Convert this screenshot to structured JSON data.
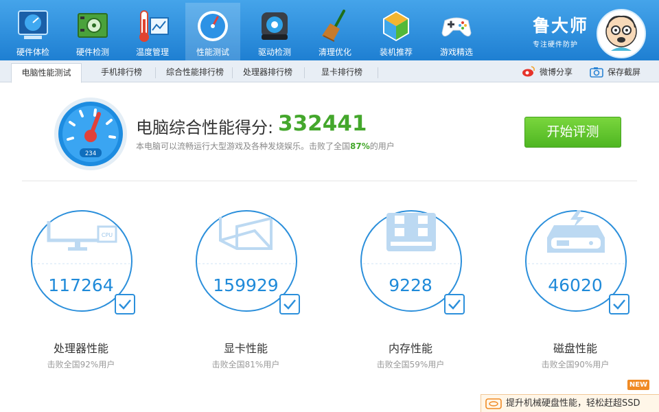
{
  "toolbar": {
    "items": [
      {
        "label": "硬件体检",
        "icon": "hardware-checkup-icon"
      },
      {
        "label": "硬件检测",
        "icon": "hardware-detect-icon"
      },
      {
        "label": "温度管理",
        "icon": "temperature-icon"
      },
      {
        "label": "性能测试",
        "icon": "performance-gauge-icon",
        "active": true
      },
      {
        "label": "驱动检测",
        "icon": "driver-icon"
      },
      {
        "label": "清理优化",
        "icon": "broom-icon"
      },
      {
        "label": "装机推荐",
        "icon": "install-recommend-icon"
      },
      {
        "label": "游戏精选",
        "icon": "gamepad-icon"
      }
    ],
    "brand_name": "鲁大师",
    "brand_sub": "专注硬件防护"
  },
  "tabs": [
    {
      "label": "电脑性能测试",
      "active": true
    },
    {
      "label": "手机排行榜"
    },
    {
      "label": "综合性能排行榜"
    },
    {
      "label": "处理器排行榜"
    },
    {
      "label": "显卡排行榜"
    }
  ],
  "share": {
    "weibo_label": "微博分享",
    "screenshot_label": "保存截屏"
  },
  "score": {
    "title": "电脑综合性能得分:",
    "value": "332441",
    "gauge_digits": "234",
    "desc_prefix": "本电脑可以流畅运行大型游戏及各种发烧娱乐。击败了全国",
    "desc_pct": "87%",
    "desc_suffix": "的用户",
    "start_button": "开始评测"
  },
  "cards": [
    {
      "value": "117264",
      "name": "处理器性能",
      "sub": "击败全国92%用户",
      "icon": "cpu-monitor-icon",
      "chip_text": "CPU"
    },
    {
      "value": "159929",
      "name": "显卡性能",
      "sub": "击败全国81%用户",
      "icon": "graphics-cube-icon"
    },
    {
      "value": "9228",
      "name": "内存性能",
      "sub": "击败全国59%用户",
      "icon": "memory-chip-icon"
    },
    {
      "value": "46020",
      "name": "磁盘性能",
      "sub": "击败全国90%用户",
      "icon": "hard-disk-icon"
    }
  ],
  "promo": {
    "badge": "NEW",
    "text": "提升机械硬盘性能，轻松赶超SSD"
  },
  "colors": {
    "toolbar_top": "#45a4ea",
    "toolbar_bottom": "#1e7fd2",
    "score_green": "#44a72c",
    "ring_blue": "#1f8ad9",
    "button_green": "#5cbf2a"
  }
}
